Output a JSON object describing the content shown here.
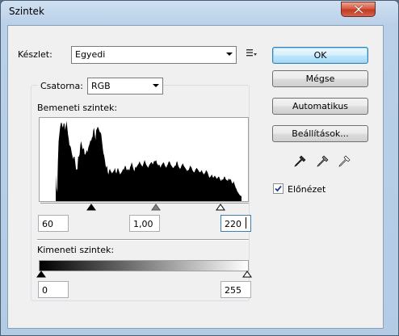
{
  "window": {
    "title": "Szintek"
  },
  "preset": {
    "label": "Készlet:",
    "value": "Egyedi"
  },
  "channel": {
    "label": "Csatorna:",
    "value": "RGB"
  },
  "input_levels": {
    "label": "Bemeneti szintek:",
    "black": "60",
    "gamma": "1,00",
    "white": "220"
  },
  "output_levels": {
    "label": "Kimeneti szintek:",
    "black": "0",
    "white": "255"
  },
  "buttons": {
    "ok": "OK",
    "cancel": "Mégse",
    "auto": "Automatikus",
    "options": "Beállítások..."
  },
  "preview": {
    "label": "Előnézet",
    "checked": true
  },
  "histogram": [
    120,
    60,
    40,
    175,
    270,
    300,
    330,
    350,
    355,
    340,
    330,
    350,
    350,
    320,
    340,
    360,
    330,
    300,
    280,
    250,
    250,
    240,
    220,
    205,
    190,
    200,
    200,
    175,
    145,
    140,
    145,
    200,
    200,
    210,
    250,
    270,
    255,
    235,
    235,
    240,
    210,
    210,
    220,
    230,
    220,
    240,
    250,
    260,
    275,
    270,
    285,
    290,
    320,
    330,
    300,
    275,
    320,
    325,
    335,
    330,
    320,
    310,
    310,
    300,
    270,
    240,
    215,
    205,
    185,
    160,
    150,
    160,
    130,
    120,
    140,
    145,
    135,
    130,
    125,
    130,
    135,
    140,
    150,
    130,
    125,
    140,
    150,
    140,
    130,
    120,
    125,
    130,
    135,
    145,
    140,
    150,
    160,
    155,
    140,
    140,
    145,
    140,
    140,
    155,
    160,
    175,
    165,
    150,
    140,
    135,
    155,
    150,
    155,
    160,
    165,
    170,
    180,
    170,
    165,
    160,
    155,
    165,
    175,
    185,
    175,
    165,
    160,
    155,
    150,
    160,
    165,
    170,
    175,
    175,
    165,
    170,
    180,
    180,
    180,
    185,
    170,
    165,
    160,
    165,
    160,
    150,
    160,
    165,
    170,
    175,
    170,
    160,
    155,
    150,
    160,
    165,
    175,
    180,
    175,
    165,
    160,
    155,
    150,
    150,
    155,
    160,
    160,
    175,
    180,
    165,
    155,
    150,
    145,
    150,
    160,
    165,
    170,
    160,
    155,
    150,
    145,
    140,
    135,
    140,
    140,
    150,
    160,
    155,
    150,
    140,
    135,
    130,
    130,
    140,
    145,
    150,
    145,
    140,
    135,
    130,
    130,
    135,
    140,
    130,
    125,
    120,
    125,
    130,
    140,
    135,
    130,
    120,
    110,
    105,
    110,
    115,
    120,
    110,
    105,
    110,
    115,
    110,
    105,
    100,
    105,
    110,
    110,
    100,
    95,
    90,
    100,
    95,
    100,
    110,
    110,
    100,
    95,
    95,
    90,
    100,
    100,
    95,
    100,
    90,
    80,
    80,
    90,
    80,
    70,
    60,
    55,
    45,
    40,
    35,
    30,
    25,
    25,
    20
  ]
}
